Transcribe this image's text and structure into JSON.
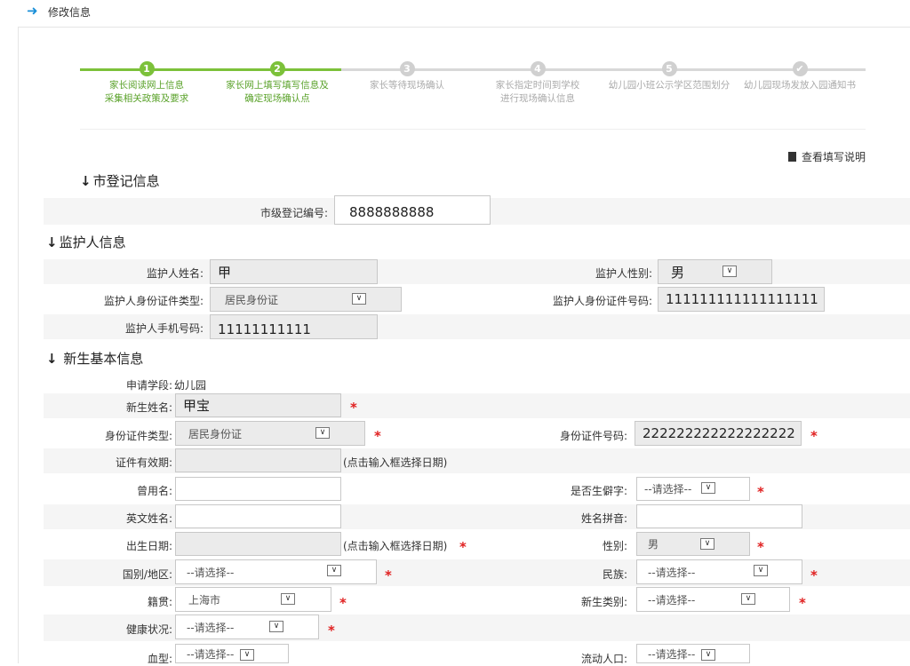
{
  "header": {
    "title": "修改信息"
  },
  "steps": [
    {
      "num": "1",
      "label1": "家长阅读网上信息",
      "label2": "采集相关政策及要求",
      "state": "done"
    },
    {
      "num": "2",
      "label1": "家长网上填写填写信息及",
      "label2": "确定现场确认点",
      "state": "done"
    },
    {
      "num": "3",
      "label1": "家长等待现场确认",
      "label2": "",
      "state": "todo"
    },
    {
      "num": "4",
      "label1": "家长指定时间到学校",
      "label2": "进行现场确认信息",
      "state": "todo"
    },
    {
      "num": "5",
      "label1": "幼儿园小班公示学区范围划分",
      "label2": "",
      "state": "todo"
    },
    {
      "num": "✔",
      "label1": "幼儿园现场发放入园通知书",
      "label2": "",
      "state": "todo"
    }
  ],
  "help_link": "查看填写说明",
  "city": {
    "section_title": "市登记信息",
    "reg_no_label": "市级登记编号:",
    "reg_no_value": "8888888888"
  },
  "guardian": {
    "section_title": "监护人信息",
    "name_label": "监护人姓名:",
    "name_value": "甲",
    "gender_label": "监护人性别:",
    "gender_value": "男",
    "id_type_label": "监护人身份证件类型:",
    "id_type_value": "居民身份证",
    "id_no_label": "监护人身份证件号码:",
    "id_no_value": "111111111111111111",
    "phone_label": "监护人手机号码:",
    "phone_value": "11111111111"
  },
  "student": {
    "section_title": "新生基本信息",
    "stage_label": "申请学段:",
    "stage_value": "幼儿园",
    "name_label": "新生姓名:",
    "name_value": "甲宝",
    "id_type_label": "身份证件类型:",
    "id_type_value": "居民身份证",
    "id_no_label": "身份证件号码:",
    "id_no_value": "222222222222222222",
    "validity_label": "证件有效期:",
    "date_hint": "(点击输入框选择日期)",
    "former_name_label": "曾用名:",
    "rare_char_label": "是否生僻字:",
    "english_name_label": "英文姓名:",
    "pinyin_label": "姓名拼音:",
    "birth_label": "出生日期:",
    "gender_label": "性别:",
    "gender_value": "男",
    "nation_label": "国别/地区:",
    "ethnic_label": "民族:",
    "native_label": "籍贯:",
    "native_value": "上海市",
    "category_label": "新生类别:",
    "health_label": "健康状况:",
    "blood_label": "血型:",
    "floating_label": "流动人口:",
    "placeholder": "--请选择--"
  },
  "required_mark": "*",
  "colors": {
    "done": "#7cc13a",
    "todo": "#d0d0d0",
    "required": "#e02020",
    "accent": "#1a8fd8"
  }
}
